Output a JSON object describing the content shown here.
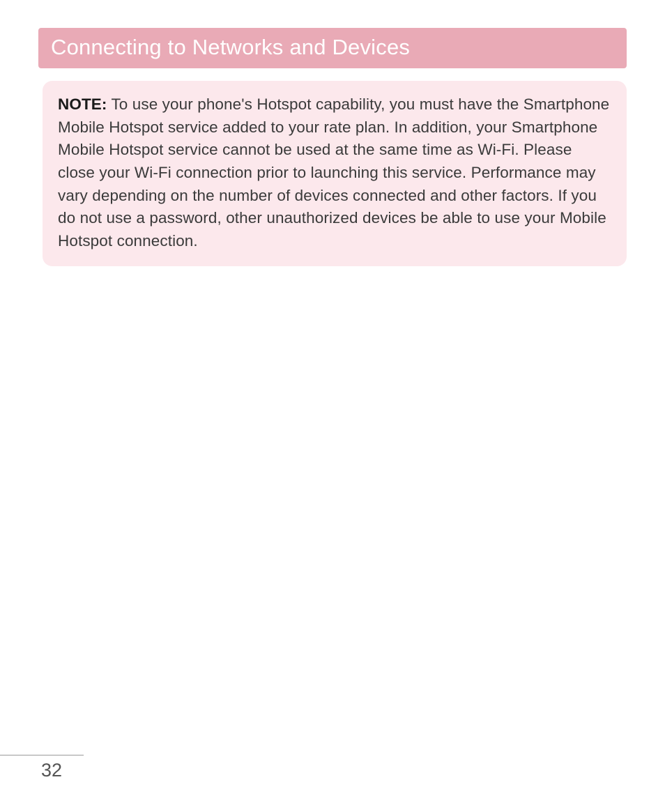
{
  "header": {
    "title": "Connecting to Networks and Devices"
  },
  "note": {
    "label": "NOTE:",
    "body": " To use your phone's Hotspot capability, you must have the Smartphone Mobile Hotspot service added to your rate plan. In addition, your Smartphone Mobile Hotspot service cannot be used at the same time as Wi-Fi. Please close your Wi-Fi connection prior to launching this service. Performance may vary depending on the number of devices connected and other factors. If you do not use a password, other unauthorized devices be able to use your Mobile Hotspot connection."
  },
  "page": {
    "number": "32"
  }
}
